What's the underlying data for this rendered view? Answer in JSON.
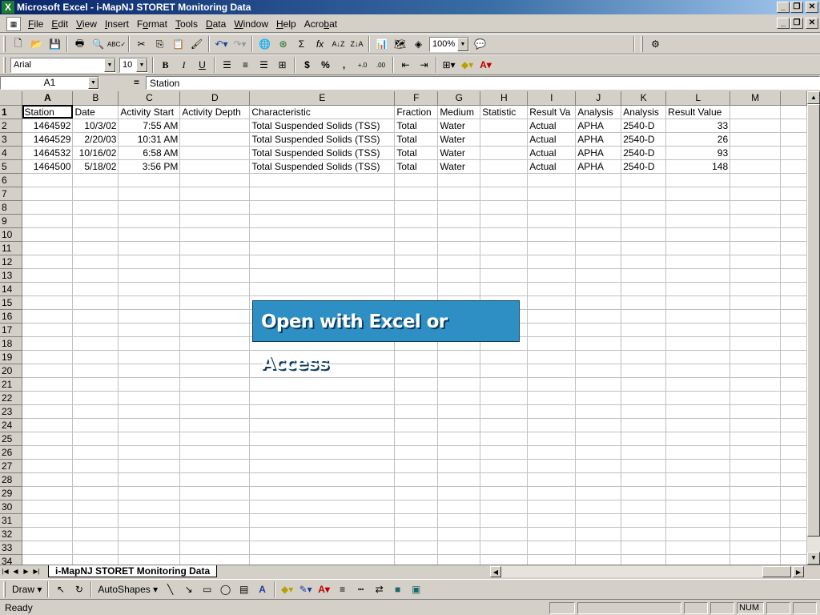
{
  "window": {
    "title": "Microsoft Excel - i-MapNJ STORET Monitoring Data"
  },
  "menu": {
    "items": [
      {
        "label": "File",
        "key": "F"
      },
      {
        "label": "Edit",
        "key": "E"
      },
      {
        "label": "View",
        "key": "V"
      },
      {
        "label": "Insert",
        "key": "I"
      },
      {
        "label": "Format",
        "key": "o"
      },
      {
        "label": "Tools",
        "key": "T"
      },
      {
        "label": "Data",
        "key": "D"
      },
      {
        "label": "Window",
        "key": "W"
      },
      {
        "label": "Help",
        "key": "H"
      },
      {
        "label": "Acrobat",
        "key": "b"
      }
    ]
  },
  "toolbar": {
    "zoom": "100%",
    "font_name": "Arial",
    "font_size": "10",
    "bold": "B",
    "italic": "I",
    "underline": "U",
    "currency": "$",
    "percent": "%",
    "comma": ",",
    "sum": "Σ",
    "fx": "fx"
  },
  "formula_bar": {
    "name_box": "A1",
    "equals": "=",
    "value": "Station"
  },
  "grid": {
    "columns": [
      "A",
      "B",
      "C",
      "D",
      "E",
      "F",
      "G",
      "H",
      "I",
      "J",
      "K",
      "L",
      "M"
    ],
    "header_row": [
      "Station",
      "Date",
      "Activity Start",
      "Activity Depth",
      "Characteristic",
      "Fraction",
      "Medium",
      "Statistic",
      "Result Va",
      "Analysis",
      "Analysis",
      "Result Value",
      ""
    ],
    "rows": [
      [
        "1464592",
        "10/3/02",
        "7:55 AM",
        "",
        "Total Suspended Solids (TSS)",
        "Total",
        "Water",
        "",
        "Actual",
        "APHA",
        "2540-D",
        "33",
        ""
      ],
      [
        "1464529",
        "2/20/03",
        "10:31 AM",
        "",
        "Total Suspended Solids (TSS)",
        "Total",
        "Water",
        "",
        "Actual",
        "APHA",
        "2540-D",
        "26",
        ""
      ],
      [
        "1464532",
        "10/16/02",
        "6:58 AM",
        "",
        "Total Suspended Solids (TSS)",
        "Total",
        "Water",
        "",
        "Actual",
        "APHA",
        "2540-D",
        "93",
        ""
      ],
      [
        "1464500",
        "5/18/02",
        "3:56 PM",
        "",
        "Total Suspended Solids (TSS)",
        "Total",
        "Water",
        "",
        "Actual",
        "APHA",
        "2540-D",
        "148",
        ""
      ]
    ],
    "row_numbers": [
      "1",
      "2",
      "3",
      "4",
      "5",
      "6",
      "7",
      "8",
      "9",
      "10",
      "11",
      "12",
      "13",
      "14",
      "15",
      "16",
      "17",
      "18",
      "19",
      "20",
      "21",
      "22",
      "23",
      "24",
      "25",
      "26",
      "27",
      "28",
      "29",
      "30",
      "31",
      "32",
      "33",
      "34"
    ]
  },
  "banner": {
    "text": "Open with Excel or Access",
    "color": "#2e8fc4"
  },
  "sheet_tabs": {
    "active": "i-MapNJ STORET Monitoring Data"
  },
  "draw_toolbar": {
    "draw": "Draw",
    "autoshapes": "AutoShapes"
  },
  "status": {
    "text": "Ready",
    "num": "NUM"
  }
}
